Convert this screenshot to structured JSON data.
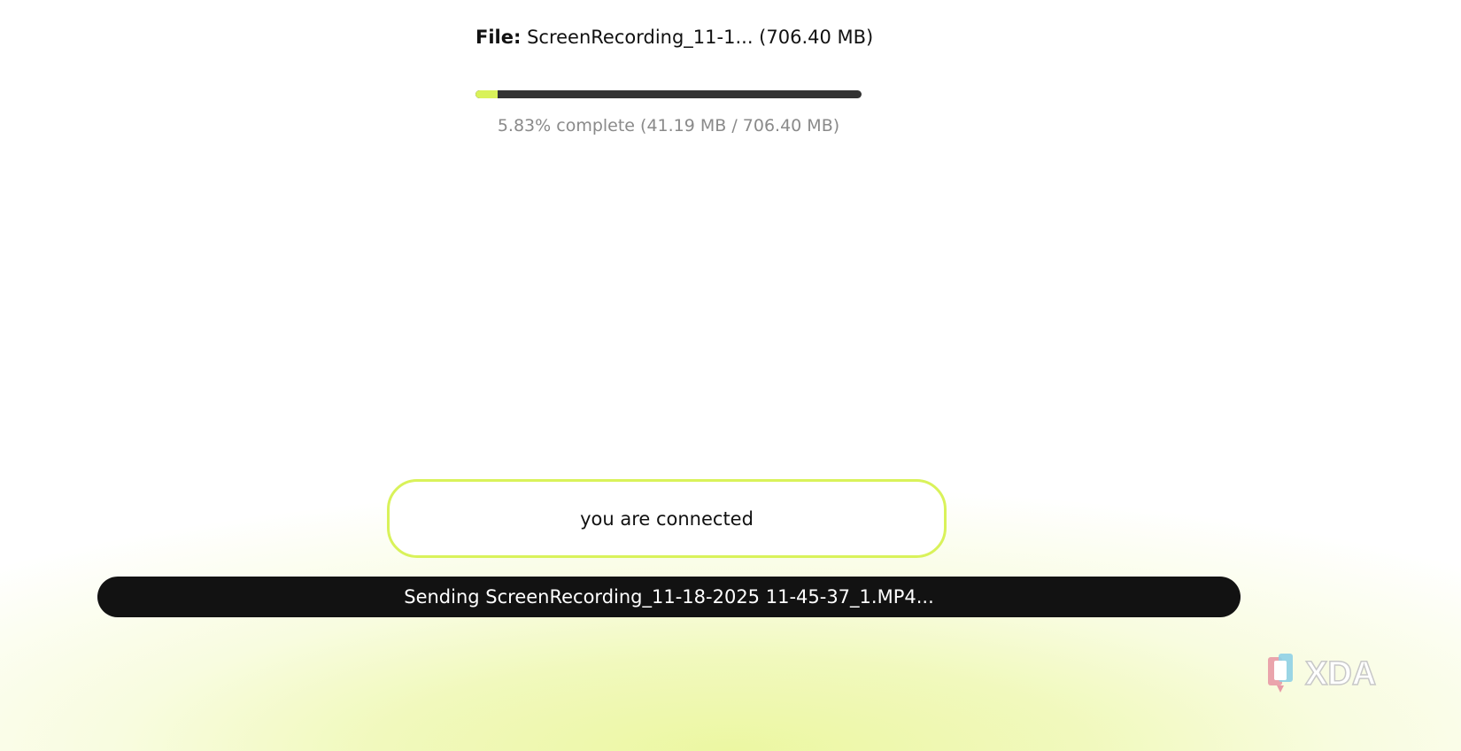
{
  "file": {
    "label": "File:",
    "name": "ScreenRecording_11-1... (706.40 MB)"
  },
  "progress": {
    "percent": 5.83,
    "text": "5.83% complete (41.19 MB / 706.40 MB)",
    "fill_color": "#d9f25a"
  },
  "status": {
    "text": "you are connected",
    "border_color": "#d9f25a"
  },
  "sending": {
    "text": "Sending ScreenRecording_11-18-2025 11-45-37_1.MP4..."
  },
  "watermark": {
    "text": "XDA"
  }
}
